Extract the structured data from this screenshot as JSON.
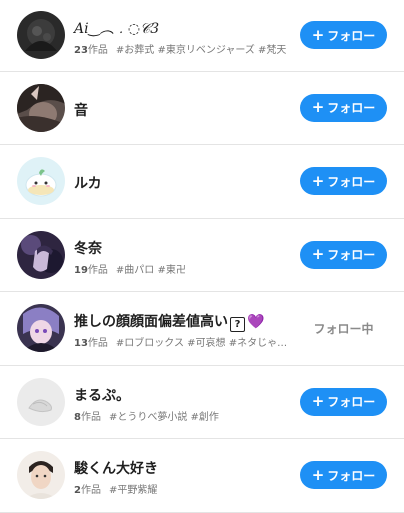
{
  "follow_label": "フォロー",
  "following_label": "フォロー中",
  "users": [
    {
      "name": "𝐴𝑖‿︵﹒◌𝒞3",
      "count": "23",
      "count_unit": "作品",
      "tags": "#お葬式 #東京リベンジャーズ #梵天"
    },
    {
      "name": "音",
      "count": "",
      "count_unit": "",
      "tags": ""
    },
    {
      "name": "ルカ",
      "count": "",
      "count_unit": "",
      "tags": ""
    },
    {
      "name": "冬奈",
      "count": "19",
      "count_unit": "作品",
      "tags": "#曲パロ #東卍"
    },
    {
      "name": "推しの顔顔面偏差値高い",
      "name_emoji": "?",
      "name_heart": "💜",
      "count": "13",
      "count_unit": "作品",
      "tags": "#ロブロックス #可哀想 #ネタじゃ…"
    },
    {
      "name": "まるぷ。",
      "count": "8",
      "count_unit": "作品",
      "tags": "#とうりべ夢小説 #創作"
    },
    {
      "name": "駿くん大好き",
      "count": "2",
      "count_unit": "作品",
      "tags": "#平野紫耀"
    }
  ],
  "colors": {
    "follow_button": "#1e90f5",
    "following_text": "#8a8a8a",
    "divider": "#e4e4e4"
  }
}
